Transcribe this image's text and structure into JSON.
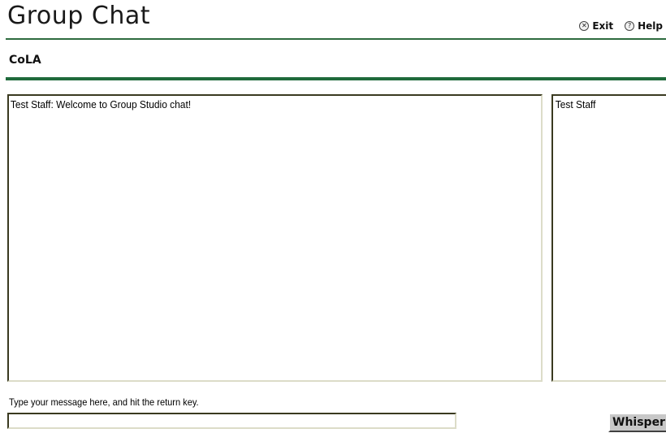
{
  "header": {
    "title": "Group Chat",
    "links": {
      "exit": {
        "label": "Exit",
        "icon": "close-circle-icon",
        "glyph": "✕"
      },
      "help": {
        "label": "Help",
        "icon": "help-circle-icon",
        "glyph": "?"
      }
    }
  },
  "group": {
    "name": "CoLA"
  },
  "chat": {
    "messages": [
      {
        "text": "Test Staff:  Welcome to Group Studio chat!"
      }
    ]
  },
  "users": [
    {
      "name": "Test Staff"
    }
  ],
  "composer": {
    "instructions": "Type your message here, and hit the return key.",
    "value": "",
    "whisper_label": "Whisper"
  },
  "colors": {
    "accent": "#1f6a3b"
  }
}
